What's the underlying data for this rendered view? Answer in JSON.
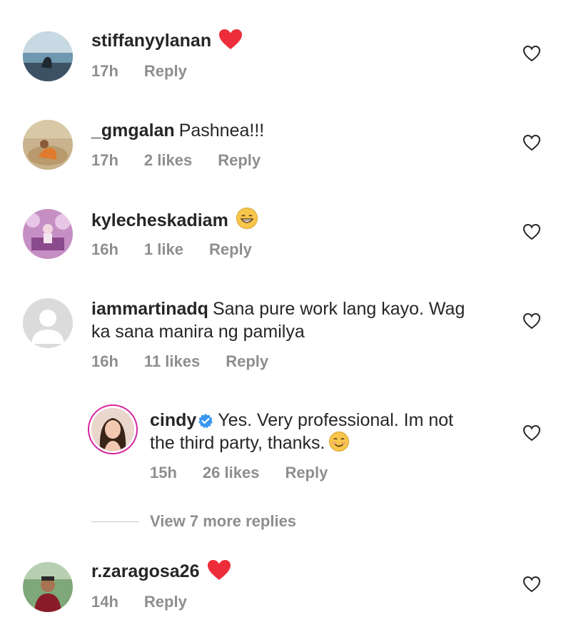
{
  "comments": [
    {
      "username": "stiffanyylanan",
      "text": "",
      "emoji": "heart-emoji",
      "time": "17h",
      "likes": "",
      "reply": "Reply"
    },
    {
      "username": "_gmgalan",
      "text": "Pashnea!!!",
      "time": "17h",
      "likes": "2 likes",
      "reply": "Reply"
    },
    {
      "username": "kylecheskadiam",
      "text": "",
      "emoji": "grinning-emoji",
      "time": "16h",
      "likes": "1 like",
      "reply": "Reply"
    },
    {
      "username": "iammartinadq",
      "text_line1": "Sana pure work lang kayo. Wag",
      "text_line2": "ka sana manira ng pamilya",
      "time": "16h",
      "likes": "11 likes",
      "reply": "Reply"
    },
    {
      "username": "cindy",
      "verified": true,
      "text_line1": "Yes. Very professional. Im not",
      "text_line2": "the third party, thanks.",
      "emoji": "smiling-emoji",
      "time": "15h",
      "likes": "26 likes",
      "reply": "Reply"
    },
    {
      "username": "r.zaragosa26",
      "text": "",
      "emoji": "heart-emoji",
      "time": "14h",
      "likes": "",
      "reply": "Reply"
    }
  ],
  "view_more": "View 7 more replies",
  "colors": {
    "text": "#262626",
    "meta": "#8e8e8e",
    "heart_emoji": "#ed2e3a",
    "verified": "#3897f0"
  }
}
